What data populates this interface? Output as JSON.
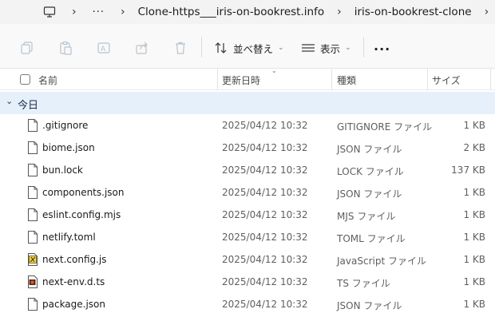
{
  "breadcrumb": {
    "icon": "computer-icon",
    "ellipsis": "···",
    "items": [
      "Clone-https___iris-on-bookrest.info",
      "iris-on-bookrest-clone"
    ]
  },
  "toolbar": {
    "sort_label": "並べ替え",
    "view_label": "表示",
    "more_label": "···"
  },
  "columns": {
    "name": "名前",
    "modified": "更新日時",
    "type": "種類",
    "size": "サイズ"
  },
  "group": {
    "label": "今日"
  },
  "files": [
    {
      "name": ".gitignore",
      "modified": "2025/04/12 10:32",
      "type": "GITIGNORE ファイル",
      "size": "1 KB",
      "icon": "file-icon"
    },
    {
      "name": "biome.json",
      "modified": "2025/04/12 10:32",
      "type": "JSON ファイル",
      "size": "2 KB",
      "icon": "file-icon"
    },
    {
      "name": "bun.lock",
      "modified": "2025/04/12 10:32",
      "type": "LOCK ファイル",
      "size": "137 KB",
      "icon": "file-icon"
    },
    {
      "name": "components.json",
      "modified": "2025/04/12 10:32",
      "type": "JSON ファイル",
      "size": "1 KB",
      "icon": "file-icon"
    },
    {
      "name": "eslint.config.mjs",
      "modified": "2025/04/12 10:32",
      "type": "MJS ファイル",
      "size": "1 KB",
      "icon": "file-icon"
    },
    {
      "name": "netlify.toml",
      "modified": "2025/04/12 10:32",
      "type": "TOML ファイル",
      "size": "1 KB",
      "icon": "file-icon"
    },
    {
      "name": "next.config.js",
      "modified": "2025/04/12 10:32",
      "type": "JavaScript ファイル",
      "size": "1 KB",
      "icon": "javascript-file-icon"
    },
    {
      "name": "next-env.d.ts",
      "modified": "2025/04/12 10:32",
      "type": "TS ファイル",
      "size": "1 KB",
      "icon": "media-file-icon"
    },
    {
      "name": "package.json",
      "modified": "2025/04/12 10:32",
      "type": "JSON ファイル",
      "size": "1 KB",
      "icon": "file-icon"
    }
  ],
  "colors": {
    "group_bg": "#e5f0fb",
    "cmdbar_bg": "#f9f9f9",
    "addr_bg": "#f3f3f3"
  }
}
